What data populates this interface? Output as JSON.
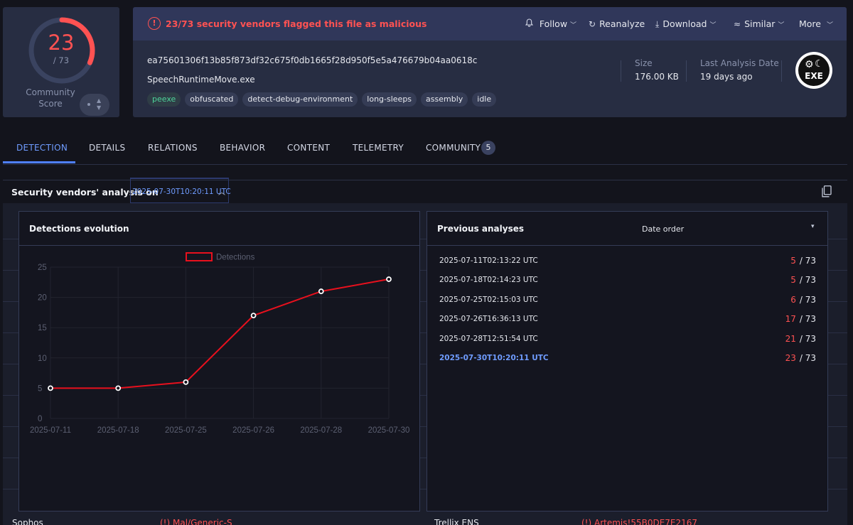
{
  "score": {
    "malicious": "23",
    "total": "/ 73",
    "fraction": 0.315,
    "community_label": "Community\nScore"
  },
  "alert": {
    "text": "23/73 security vendors flagged this file as malicious",
    "color": "#ff5252"
  },
  "actions": {
    "follow": "Follow",
    "reanalyze": "Reanalyze",
    "download": "Download",
    "similar": "Similar",
    "more": "More"
  },
  "file": {
    "hash": "ea75601306f13b85f873df32c675f0db1665f28d950f5e5a476679b04aa0618c",
    "name": "SpeechRuntimeMove.exe",
    "tags": [
      "peexe",
      "obfuscated",
      "detect-debug-environment",
      "long-sleeps",
      "assembly",
      "idle"
    ],
    "size_label": "Size",
    "size_value": "176.00 KB",
    "last_analysis_label": "Last Analysis Date",
    "last_analysis_value": "19 days ago",
    "type_icon_text": "EXE"
  },
  "tabs": {
    "detection": "DETECTION",
    "details": "DETAILS",
    "relations": "RELATIONS",
    "behavior": "BEHAVIOR",
    "content": "CONTENT",
    "telemetry": "TELEMETRY",
    "community": "COMMUNITY",
    "community_count": "5"
  },
  "vendors": {
    "title": "Security vendors' analysis on",
    "selected_date": "2025-07-30T10:20:11 UTC",
    "rows": [
      {
        "vendor": "Sophos",
        "result": "Mal/Generic-S"
      },
      {
        "vendor": "Trellix ENS",
        "result": "Artemis!55B0DE7E2167"
      }
    ]
  },
  "evolution": {
    "title": "Detections evolution"
  },
  "chart_data": {
    "type": "line",
    "categories": [
      "2025-07-11",
      "2025-07-18",
      "2025-07-25",
      "2025-07-26",
      "2025-07-28",
      "2025-07-30"
    ],
    "series": [
      {
        "name": "Detections",
        "values": [
          5,
          5,
          6,
          17,
          21,
          23
        ],
        "color": "#e8101d"
      }
    ],
    "ylim": [
      0,
      25
    ],
    "yticks": [
      0,
      5,
      10,
      15,
      20,
      25
    ],
    "grid": true,
    "legend": "top-center"
  },
  "previous": {
    "title": "Previous analyses",
    "sort_label": "Date order",
    "items": [
      {
        "date": "2025-07-11T02:13:22 UTC",
        "positives": "5",
        "total": "/ 73",
        "current": false
      },
      {
        "date": "2025-07-18T02:14:23 UTC",
        "positives": "5",
        "total": "/ 73",
        "current": false
      },
      {
        "date": "2025-07-25T02:15:03 UTC",
        "positives": "6",
        "total": "/ 73",
        "current": false
      },
      {
        "date": "2025-07-26T16:36:13 UTC",
        "positives": "17",
        "total": "/ 73",
        "current": false
      },
      {
        "date": "2025-07-28T12:51:54 UTC",
        "positives": "21",
        "total": "/ 73",
        "current": false
      },
      {
        "date": "2025-07-30T10:20:11 UTC",
        "positives": "23",
        "total": "/ 73",
        "current": true
      }
    ]
  }
}
